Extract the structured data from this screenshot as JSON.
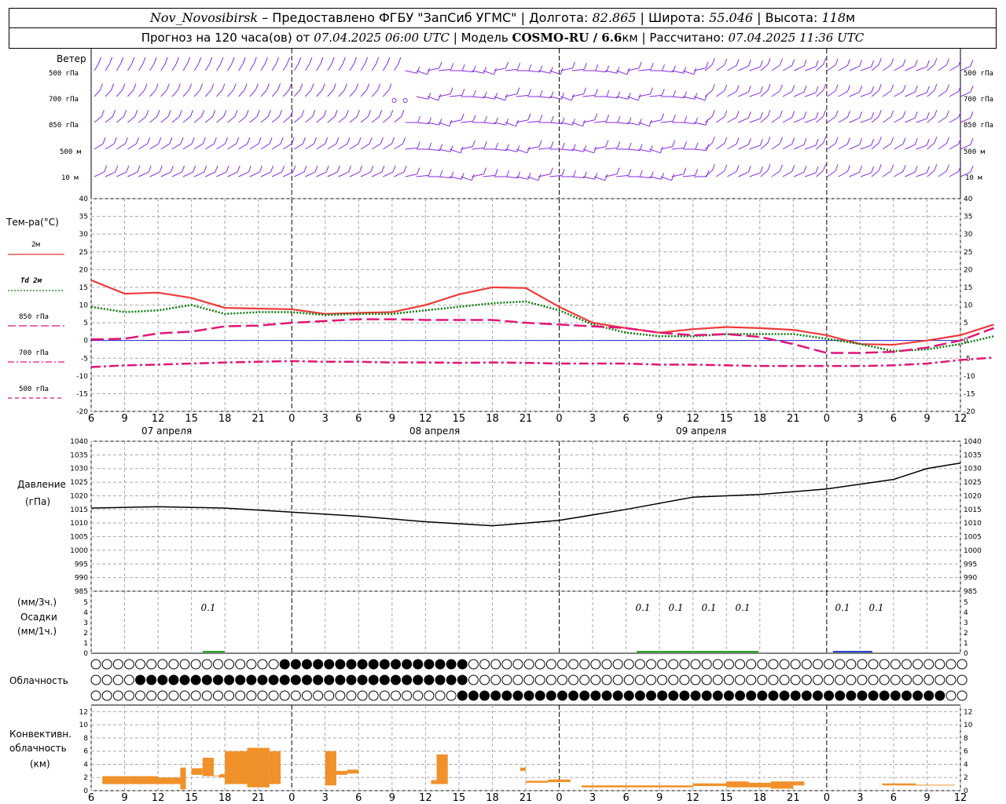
{
  "header": {
    "station": "Nov_Novosibirsk",
    "provider": "– Предоставлено ФГБУ \"ЗапСиб УГМС\"",
    "lon_label": "Долгота:",
    "lon": "82.865",
    "lat_label": "Широта:",
    "lat": "55.046",
    "alt_label": "Высота:",
    "alt": "118",
    "alt_unit": "м",
    "forecast_prefix": "Прогноз на 120 часа(ов) от",
    "forecast_time": "07.04.2025 06:00 UTC",
    "model_label": "Модель",
    "model": "COSMO-RU / 6.6",
    "model_unit": "км",
    "computed_label": "Рассчитано:",
    "computed_time": "07.04.2025 11:36 UTC"
  },
  "wind_panel": {
    "title": "Ветер",
    "levels": [
      "500 гПа",
      "700 гПа",
      "850 гПа",
      "500 м",
      "10 м"
    ]
  },
  "temp_panel": {
    "title": "Тем-ра(°C)",
    "legend": [
      {
        "label": "2м",
        "color": "#ee3b3b",
        "style": "solid"
      },
      {
        "label": "Td 2м",
        "color": "#0a7a0a",
        "style": "dotted"
      },
      {
        "label": "850 гПа",
        "color": "#e0157a",
        "style": "longdash"
      },
      {
        "label": "700 гПа",
        "color": "#e0157a",
        "style": "dashdot"
      },
      {
        "label": "500 гПа",
        "color": "#e0157a",
        "style": "dashed"
      }
    ]
  },
  "time_axis": {
    "ticks": [
      "6",
      "9",
      "12",
      "15",
      "18",
      "21",
      "0",
      "3",
      "6",
      "9",
      "12",
      "15",
      "18",
      "21",
      "0",
      "3",
      "6",
      "9",
      "12",
      "15",
      "18",
      "21",
      "0",
      "3",
      "6",
      "9",
      "12"
    ],
    "days": [
      "07 апреля",
      "08 апреля",
      "09 апреля"
    ]
  },
  "pressure_panel": {
    "title": "Давление",
    "unit": "(гПа)"
  },
  "precip_panel": {
    "title": "Осадки",
    "unit_top": "(мм/3ч.)",
    "unit_bottom": "(мм/1ч.)",
    "values": [
      "0.1",
      "0.1",
      "0.1",
      "0.1",
      "0.1",
      "0.1",
      "0.1"
    ]
  },
  "cloud_panel": {
    "title": "Облачность"
  },
  "conv_panel": {
    "title_1": "Конвективн.",
    "title_2": "облачность",
    "unit": "(км)"
  },
  "chart_data": [
    {
      "type": "line",
      "title": "Тем-ра(°C)",
      "ylim": [
        -20,
        40
      ],
      "x_hours": [
        0,
        3,
        6,
        9,
        12,
        15,
        18,
        21,
        24,
        27,
        30,
        33,
        36,
        39,
        42,
        45,
        48,
        51,
        54,
        57,
        60,
        63,
        66,
        69,
        72,
        75,
        78
      ],
      "series": [
        {
          "name": "2м",
          "values": [
            17,
            13.2,
            13.5,
            12,
            9.2,
            9,
            8.8,
            7.5,
            7.8,
            8,
            10,
            13,
            15,
            14.8,
            9.5,
            5,
            3.5,
            2.2,
            3.2,
            3.8,
            3.5,
            3,
            1.5,
            -1,
            -1.2,
            0,
            1.5,
            4.5
          ]
        },
        {
          "name": "Td 2м",
          "values": [
            9.5,
            8,
            8.5,
            10,
            7.5,
            8,
            8,
            7.2,
            7.5,
            7.5,
            8.5,
            9.5,
            10.5,
            11,
            8.5,
            4.5,
            2.2,
            1.2,
            1.2,
            1.8,
            1.8,
            1.8,
            0.5,
            -1,
            -3,
            -2.5,
            -1,
            1.2
          ]
        },
        {
          "name": "850 гПа",
          "values": [
            0.3,
            0.5,
            2,
            2.5,
            4,
            4.2,
            5,
            5.5,
            6,
            6,
            5.8,
            5.8,
            5.8,
            5,
            4.5,
            4,
            3.5,
            2.2,
            1.5,
            1.8,
            1,
            -1,
            -3.5,
            -3.5,
            -3.2,
            -2,
            0,
            3.5
          ]
        },
        {
          "name": "700 гПа",
          "values": [
            -7.5,
            -7,
            -6.8,
            -6.5,
            -6.2,
            -6,
            -5.8,
            -6,
            -6,
            -6.2,
            -6.2,
            -6.3,
            -6.2,
            -6.3,
            -6.5,
            -6.5,
            -6.5,
            -6.8,
            -6.8,
            -7,
            -7.2,
            -7.2,
            -7.2,
            -7.2,
            -7,
            -6.5,
            -5.5,
            -4.8
          ]
        }
      ]
    },
    {
      "type": "line",
      "title": "Давление",
      "ylim": [
        985,
        1040
      ],
      "x_hours": [
        0,
        6,
        12,
        18,
        24,
        30,
        36,
        42,
        48,
        54,
        60,
        66,
        72,
        75,
        78
      ],
      "series": [
        {
          "name": "Давление",
          "values": [
            1015.5,
            1016,
            1015.5,
            1014,
            1012.5,
            1010.5,
            1009,
            1011,
            1015,
            1019.5,
            1020.5,
            1022.5,
            1026,
            1030,
            1032
          ]
        }
      ]
    },
    {
      "type": "bar",
      "title": "Конвективн. облачность",
      "ylim": [
        0,
        12
      ],
      "segments_hours": [
        [
          1,
          3.5
        ],
        [
          3.5,
          6
        ],
        [
          6,
          8
        ],
        [
          8,
          8.5
        ],
        [
          9,
          10
        ],
        [
          10,
          11
        ],
        [
          11,
          11.5
        ],
        [
          11.5,
          12
        ],
        [
          12,
          14
        ],
        [
          14,
          15
        ],
        [
          15,
          17
        ],
        [
          17,
          18
        ],
        [
          18,
          19
        ],
        [
          19,
          20
        ],
        [
          20,
          21
        ],
        [
          21,
          22
        ],
        [
          23,
          25
        ],
        [
          25,
          26
        ],
        [
          30.5,
          31
        ],
        [
          31,
          33
        ],
        [
          46,
          47
        ],
        [
          47,
          48
        ],
        [
          48,
          49
        ],
        [
          49,
          50
        ],
        [
          50,
          51
        ]
      ],
      "note": "approximate bands of convective cloud layer"
    }
  ],
  "colors": {
    "wind": "#8a2be2",
    "t2m": "#ee3b3b",
    "td": "#0a7a0a",
    "isobaric": "#e0157a",
    "pressure": "#000000",
    "conv": "#f0912a",
    "precip": "#22aa22",
    "zero": "#2222cc"
  }
}
